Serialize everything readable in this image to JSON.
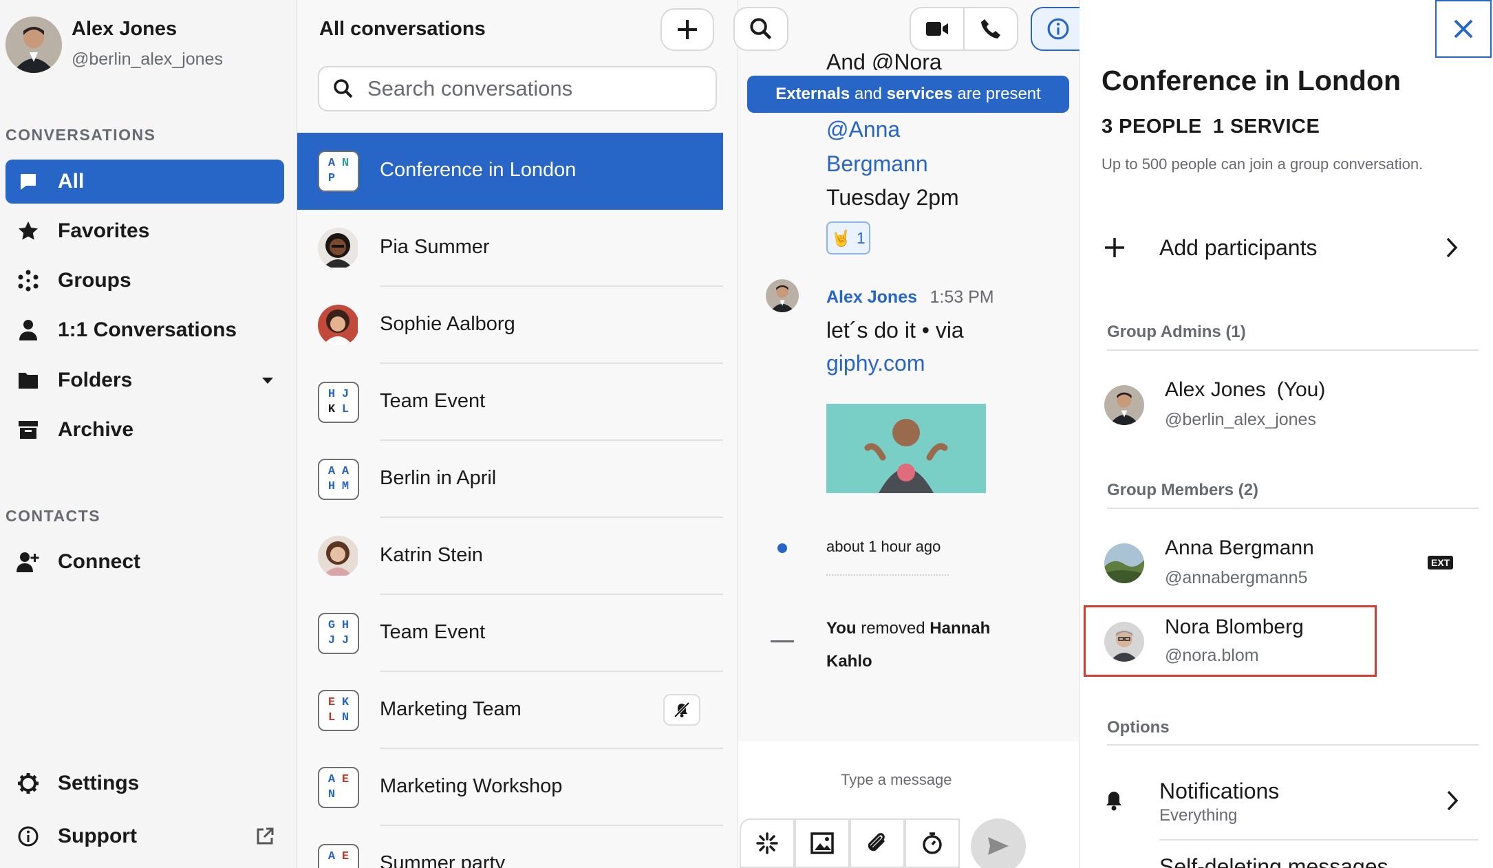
{
  "user": {
    "name": "Alex Jones",
    "handle": "@berlin_alex_jones"
  },
  "sidebar": {
    "conversations_heading": "CONVERSATIONS",
    "items": [
      {
        "label": "All",
        "icon": "chat-bubble-icon",
        "active": true
      },
      {
        "label": "Favorites",
        "icon": "star-icon"
      },
      {
        "label": "Groups",
        "icon": "groups-icon"
      },
      {
        "label": "1:1 Conversations",
        "icon": "person-icon"
      },
      {
        "label": "Folders",
        "icon": "folder-icon"
      },
      {
        "label": "Archive",
        "icon": "archive-icon"
      }
    ],
    "contacts_heading": "CONTACTS",
    "connect_label": "Connect",
    "settings_label": "Settings",
    "support_label": "Support"
  },
  "conv_list": {
    "title": "All conversations",
    "search_placeholder": "Search conversations",
    "items": [
      {
        "name": "Conference in London",
        "initials": [
          "A",
          "N",
          "P",
          ""
        ],
        "active": true
      },
      {
        "name": "Pia Summer"
      },
      {
        "name": "Sophie Aalborg"
      },
      {
        "name": "Team Event",
        "initials": [
          "H",
          "J",
          "K",
          "L"
        ]
      },
      {
        "name": "Berlin in April",
        "initials": [
          "A",
          "A",
          "H",
          "M"
        ]
      },
      {
        "name": "Katrin Stein"
      },
      {
        "name": "Team Event",
        "initials": [
          "G",
          "H",
          "J",
          "J"
        ]
      },
      {
        "name": "Marketing Team",
        "initials": [
          "E",
          "K",
          "L",
          "N"
        ],
        "muted": true
      },
      {
        "name": "Marketing Workshop",
        "initials": [
          "A",
          "E",
          "N",
          ""
        ]
      },
      {
        "name": "Summer party",
        "initials": [
          "A",
          "E",
          "",
          ""
        ]
      }
    ]
  },
  "chat": {
    "banner_externals": "Externals",
    "banner_and": " and ",
    "banner_services": "services",
    "banner_rest": " are present",
    "partial_top": "And @Nora",
    "mention_line1": "@Anna",
    "mention_line2": "Bergmann",
    "msg_line3": "Tuesday 2pm",
    "reaction_count": "1",
    "reaction_emoji": "🤘",
    "sender": "Alex Jones",
    "time": "1:53 PM",
    "msg2_line1": "let´s do it • via",
    "msg2_link": "giphy.com",
    "status_time": "about 1 hour ago",
    "removed_prefix": "You",
    "removed_mid": " removed ",
    "removed_name1": "Hannah",
    "removed_name2": "Kahlo",
    "composer_placeholder": "Type a message"
  },
  "details": {
    "title": "Conference in London",
    "people_count": "3 PEOPLE",
    "service_count": "1 SERVICE",
    "note": "Up to 500 people can join a group conversation.",
    "add_participants": "Add participants",
    "admins_heading": "Group Admins (1)",
    "admins": [
      {
        "name": "Alex Jones",
        "you": "(You)",
        "handle": "@berlin_alex_jones"
      }
    ],
    "members_heading": "Group Members (2)",
    "members": [
      {
        "name": "Anna Bergmann",
        "handle": "@annabergmann5",
        "badge": "EXT"
      },
      {
        "name": "Nora Blomberg",
        "handle": "@nora.blom"
      }
    ],
    "options_heading": "Options",
    "notifications_label": "Notifications",
    "notifications_value": "Everything",
    "partial_next": "Self-deleting messages"
  },
  "colors": {
    "accent": "#2765c7",
    "highlight_border": "#d93a2f"
  }
}
